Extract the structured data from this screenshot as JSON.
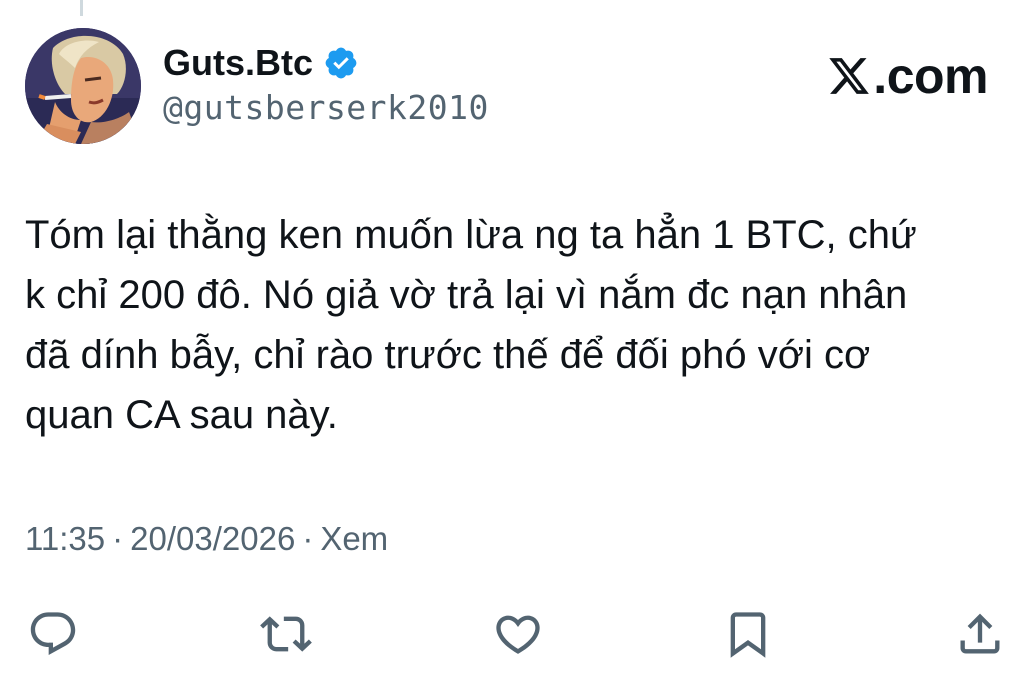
{
  "tweet": {
    "author": {
      "display_name": "Guts.Btc",
      "handle": "@gutsberserk2010",
      "verified_icon": "verified-badge-icon",
      "avatar_icon": "avatar-portrait"
    },
    "brand": {
      "logo_icon": "x-logo-icon",
      "text": ".com"
    },
    "text": "Tóm lại thằng ken muốn lừa ng ta hẳn 1 BTC, chứ\nk chỉ 200 đô. Nó giả vờ trả lại vì nắm đc nạn nhân\nđã dính bẫy, chỉ rào trước thế để đối phó với cơ\nquan CA sau này.",
    "meta": {
      "time": "11:35",
      "separator": "·",
      "date": "20/03/2026",
      "views_label": "Xem"
    },
    "actions": [
      {
        "name": "reply",
        "icon": "reply-icon"
      },
      {
        "name": "retweet",
        "icon": "retweet-icon"
      },
      {
        "name": "like",
        "icon": "heart-icon"
      },
      {
        "name": "bookmark",
        "icon": "bookmark-icon"
      },
      {
        "name": "share",
        "icon": "share-icon"
      }
    ]
  },
  "colors": {
    "text_primary": "#0f1419",
    "text_secondary": "#536471",
    "verified_blue": "#1d9bf0",
    "thread_line": "#cfd9de"
  }
}
